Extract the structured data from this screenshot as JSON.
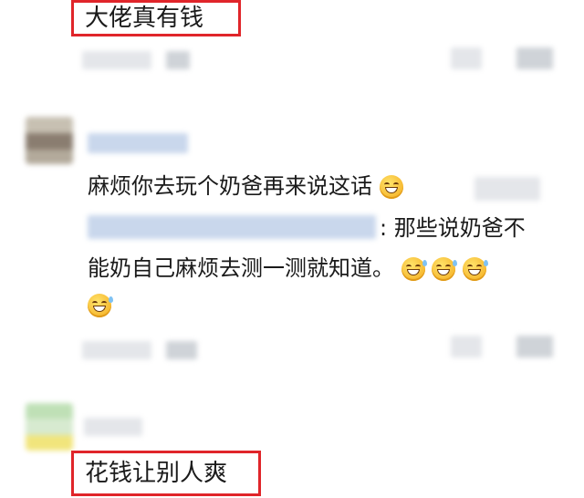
{
  "top_comment": {
    "text": "大佬真有钱"
  },
  "reply": {
    "line1": "麻烦你去玩个奶爸再来说这话",
    "line2": ": 那些说奶爸不",
    "line3": "能奶自己麻烦去测一测就知道。"
  },
  "bottom_comment": {
    "text": "花钱让别人爽"
  },
  "icons": [
    "smile-emoji-icon",
    "grinning-sweat-emoji-icon"
  ]
}
